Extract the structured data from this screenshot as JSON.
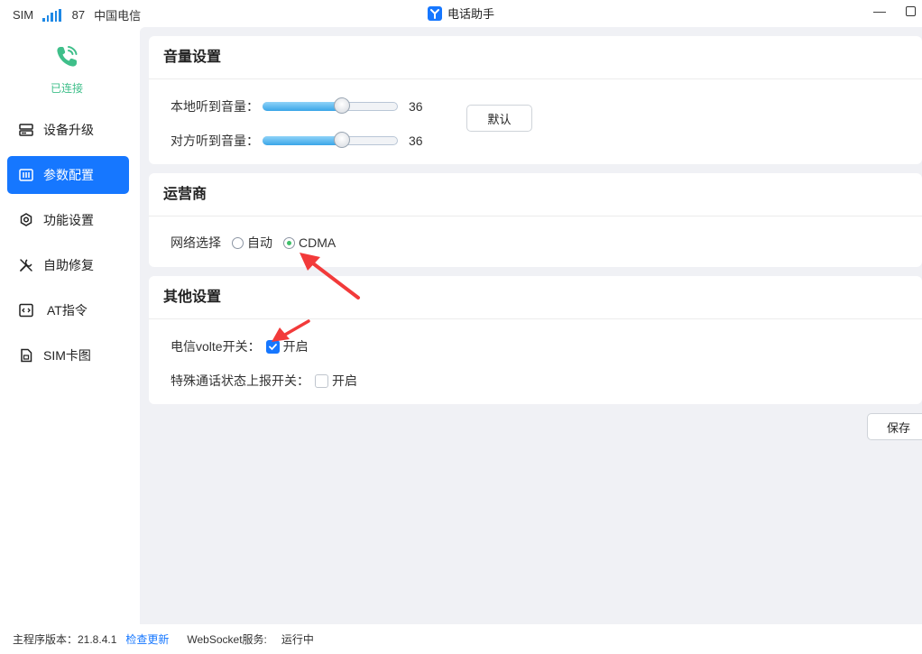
{
  "titlebar": {
    "sim_label": "SIM",
    "signal_value": "87",
    "carrier": "中国电信",
    "app_title": "电话助手",
    "minimize": "—"
  },
  "sidebar": {
    "connection_status": "已连接",
    "items": [
      {
        "label": "设备升级",
        "icon": "server-icon"
      },
      {
        "label": "参数配置",
        "icon": "config-icon"
      },
      {
        "label": "功能设置",
        "icon": "gear-icon"
      },
      {
        "label": "自助修复",
        "icon": "wrench-icon"
      },
      {
        "label": "AT指令",
        "icon": "code-icon"
      },
      {
        "label": "SIM卡图",
        "icon": "sim-card-icon"
      }
    ],
    "active_index": 1
  },
  "volume": {
    "title": "音量设置",
    "local_label": "本地听到音量：",
    "local_value": "36",
    "remote_label": "对方听到音量：",
    "remote_value": "36",
    "default_button": "默认"
  },
  "carrier_card": {
    "title": "运营商",
    "network_label": "网络选择",
    "options": [
      "自动",
      "CDMA"
    ],
    "selected": "CDMA"
  },
  "other": {
    "title": "其他设置",
    "volte_label": "电信volte开关：",
    "volte_option": "开启",
    "volte_checked": true,
    "special_label": "特殊通话状态上报开关：",
    "special_option": "开启",
    "special_checked": false
  },
  "save_button": "保存",
  "footer": {
    "version_label": "主程序版本：21.8.4.1",
    "check_update": "检查更新",
    "websocket_label": "WebSocket服务:",
    "websocket_status": "运行中"
  },
  "colors": {
    "accent": "#1677ff",
    "connected": "#3fbf8a",
    "annotation_arrow": "#f23a3a"
  }
}
